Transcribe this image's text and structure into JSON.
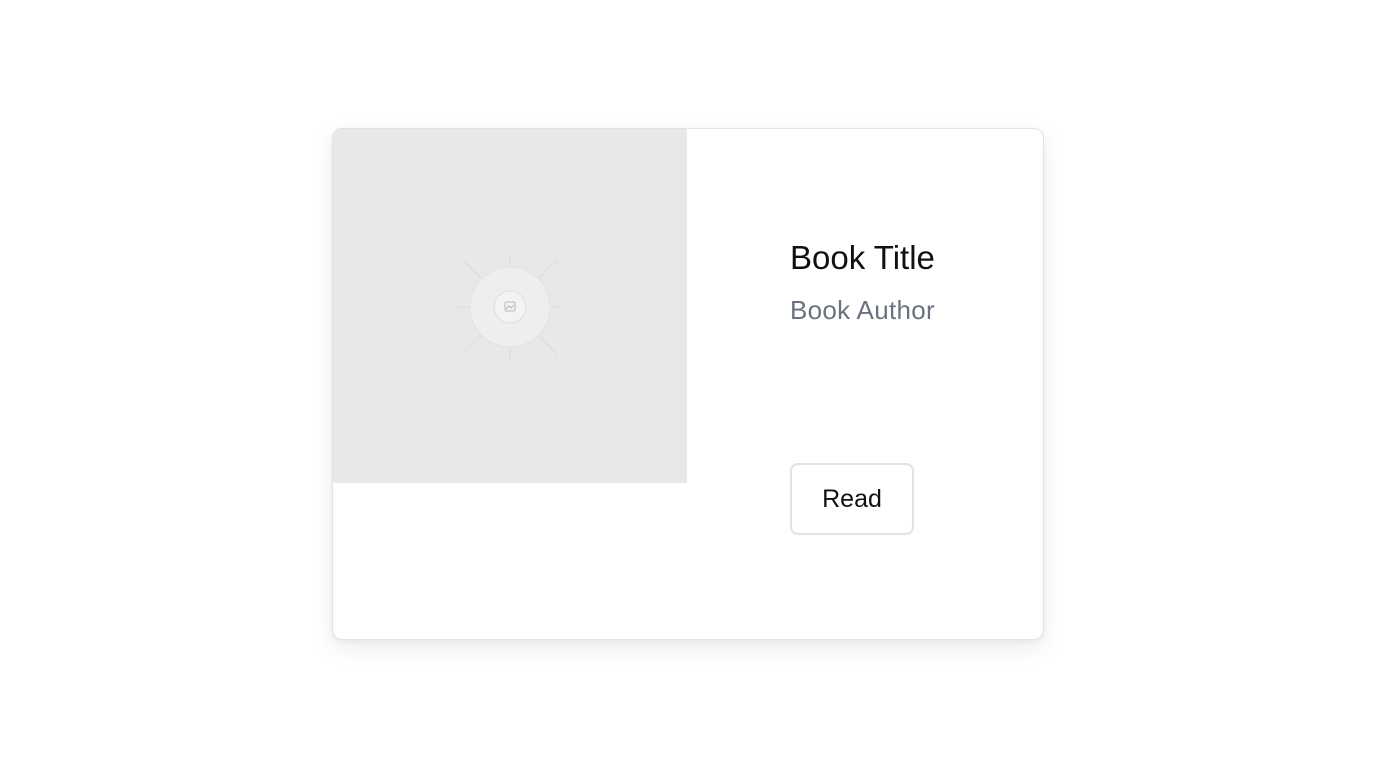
{
  "book": {
    "title": "Book Title",
    "author": "Book Author",
    "cover_icon": "image-placeholder-icon"
  },
  "actions": {
    "read_label": "Read"
  },
  "colors": {
    "cover_background": "#e8e8e8",
    "author_text": "#6b7280",
    "border": "#e2e2e2"
  }
}
